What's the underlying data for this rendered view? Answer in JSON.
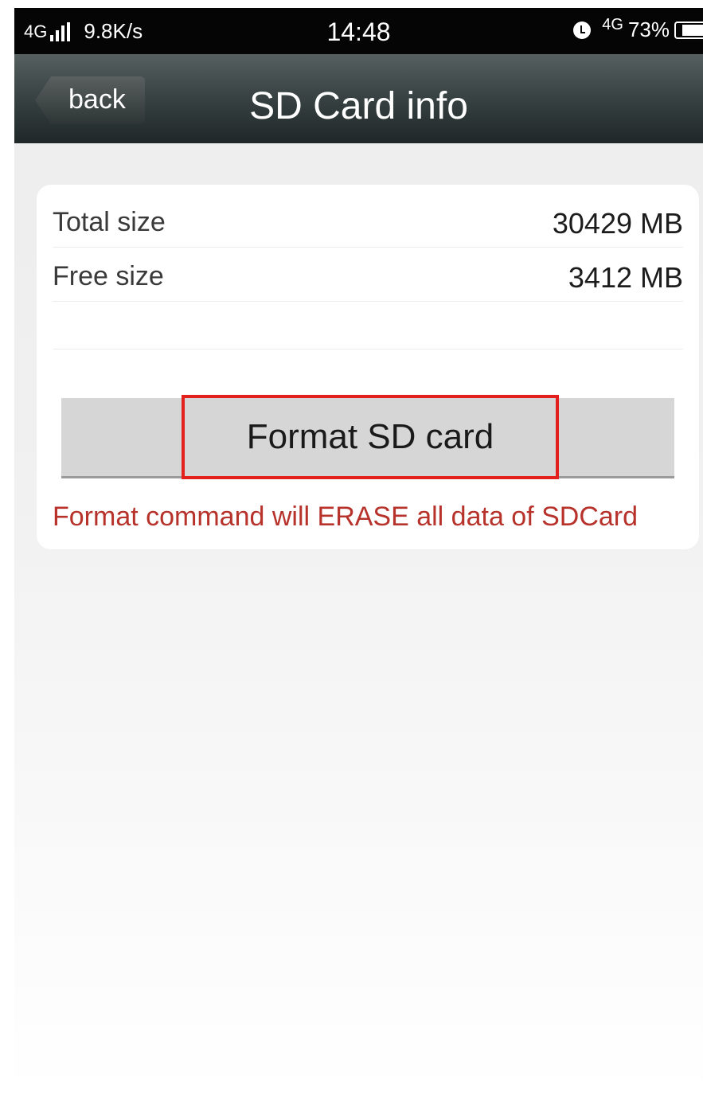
{
  "status_bar": {
    "network_left": "4G",
    "speed": "9.8K/s",
    "time": "14:48",
    "network_right": "4G",
    "battery": "73%",
    "icons": [
      "signal-icon",
      "alarm-icon",
      "battery-icon"
    ]
  },
  "nav": {
    "back_label": "back",
    "title": "SD Card info"
  },
  "info": {
    "rows": [
      {
        "label": "Total size",
        "value": "30429 MB"
      },
      {
        "label": "Free size",
        "value": "3412 MB"
      }
    ]
  },
  "actions": {
    "format_label": "Format SD card",
    "highlight_color": "#e3201d"
  },
  "warning": {
    "text": "Format command will ERASE all data of SDCard",
    "color": "#b7322b"
  }
}
